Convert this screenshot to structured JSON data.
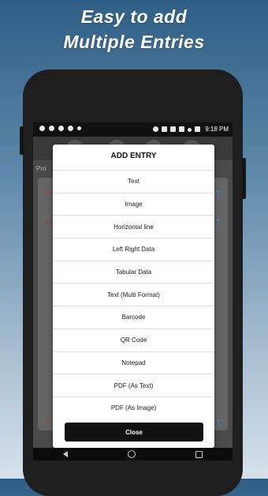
{
  "promo": {
    "line1": "Easy to add",
    "line2": "Multiple Entries"
  },
  "status_bar": {
    "time": "9:18 PM",
    "left_icons": [
      "chat-icon",
      "message-icon",
      "sync-icon",
      "whatsapp-icon",
      "more-icon"
    ],
    "right_icons": [
      "alarm-icon",
      "vibrate-icon",
      "wifi-icon",
      "data-icon",
      "signal-icon",
      "battery-icon"
    ]
  },
  "background_app": {
    "label": "Pro",
    "row_numbers": [
      "01",
      "02",
      "03"
    ],
    "arrow_icon": "arrow-up-icon"
  },
  "dialog": {
    "title": "ADD ENTRY",
    "options": [
      "Text",
      "Image",
      "Horizontal line",
      "Left Right Data",
      "Tabular Data",
      "Text (Multi Format)",
      "Barcode",
      "QR Code",
      "Notepad",
      "PDF (As Text)",
      "PDF (As Image)"
    ],
    "close_label": "Close"
  },
  "nav_bar": {
    "icons": [
      "back-icon",
      "home-icon",
      "recents-icon"
    ]
  },
  "colors": {
    "dialog_bg": "#ffffff",
    "close_button_bg": "#111111",
    "accent_arrow": "#5a83c9",
    "row_number": "#a33b3b"
  }
}
